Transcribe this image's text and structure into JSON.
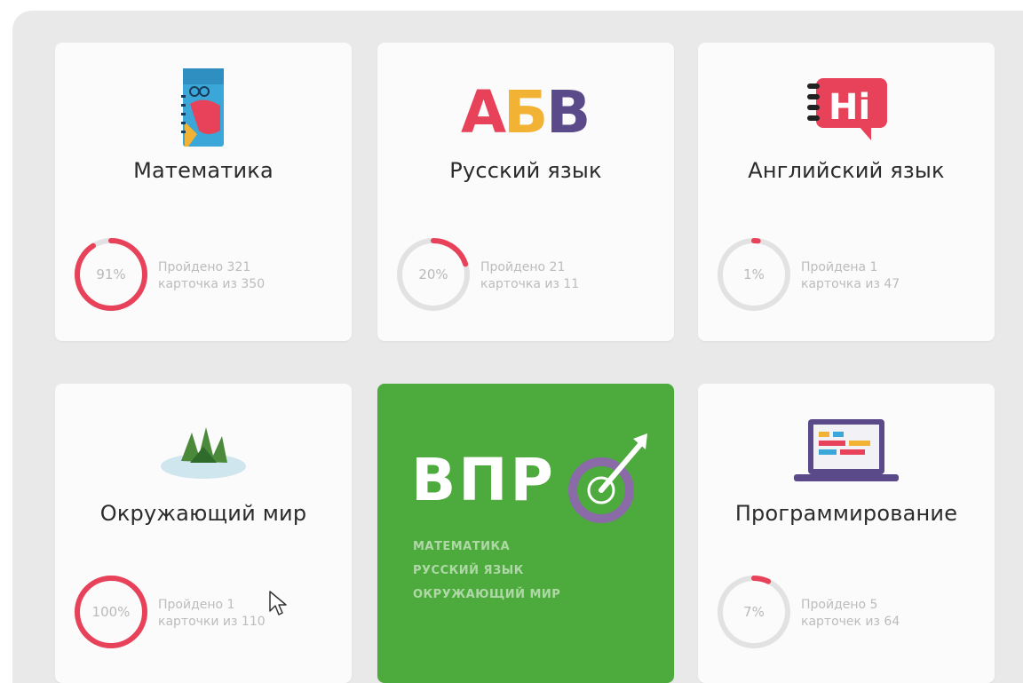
{
  "subjects": [
    {
      "title": "Математика",
      "percent_label": "91%",
      "percent": 91,
      "line1": "Пройдено 321",
      "line2": "карточка из 350",
      "icon": "notebook-icon"
    },
    {
      "title": "Русский язык",
      "percent_label": "20%",
      "percent": 20,
      "line1": "Пройдено 21",
      "line2": "карточка из 11",
      "icon": "abv-letters-icon"
    },
    {
      "title": "Английский язык",
      "percent_label": "1%",
      "percent": 1,
      "line1": "Пройдена 1",
      "line2": "карточка из 47",
      "icon": "hi-speech-bubble-icon"
    },
    {
      "title": "Окружающий мир",
      "percent_label": "100%",
      "percent": 100,
      "line1": "Пройдено 1",
      "line2": "карточки из 110",
      "icon": "plant-icon"
    },
    {
      "title": "Программирование",
      "percent_label": "7%",
      "percent": 7,
      "line1": "Пройдено 5",
      "line2": "карточек из 64",
      "icon": "laptop-icon"
    }
  ],
  "vpr": {
    "title": "ВПР",
    "items": [
      "МАТЕМАТИКА",
      "РУССКИЙ ЯЗЫК",
      "ОКРУЖАЮЩИЙ МИР"
    ],
    "icon": "target-arrow-icon"
  },
  "colors": {
    "accent": "#e8425a",
    "track": "#e2e2e2",
    "vpr_green": "#4daa3c",
    "vpr_ring": "#8b6aa8"
  }
}
